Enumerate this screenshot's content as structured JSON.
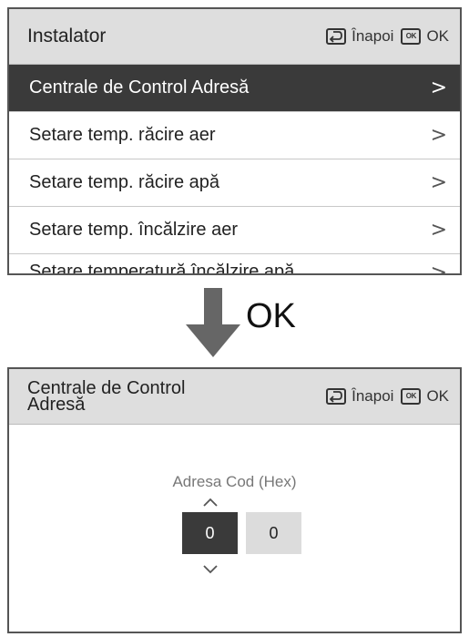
{
  "screen1": {
    "title": "Instalator",
    "back_label": "Înapoi",
    "ok_label": "OK",
    "ok_icon_text": "OK",
    "items": [
      {
        "label": "Centrale de Control Adresă",
        "selected": true
      },
      {
        "label": "Setare temp. răcire aer"
      },
      {
        "label": "Setare temp. răcire apă"
      },
      {
        "label": "Setare temp. încălzire aer"
      },
      {
        "label": "Setare temperatură încălzire apă"
      }
    ],
    "chevron": ">"
  },
  "transition": {
    "label": "OK"
  },
  "screen2": {
    "title_line1": "Centrale de Control",
    "title_line2": "Adresă",
    "back_label": "Înapoi",
    "ok_label": "OK",
    "ok_icon_text": "OK",
    "field_label": "Adresa Cod (Hex)",
    "digits": [
      "0",
      "0"
    ]
  },
  "colors": {
    "header_bg": "#dedede",
    "selected_bg": "#3a3a3a",
    "digit_inactive_bg": "#dcdcdc"
  }
}
